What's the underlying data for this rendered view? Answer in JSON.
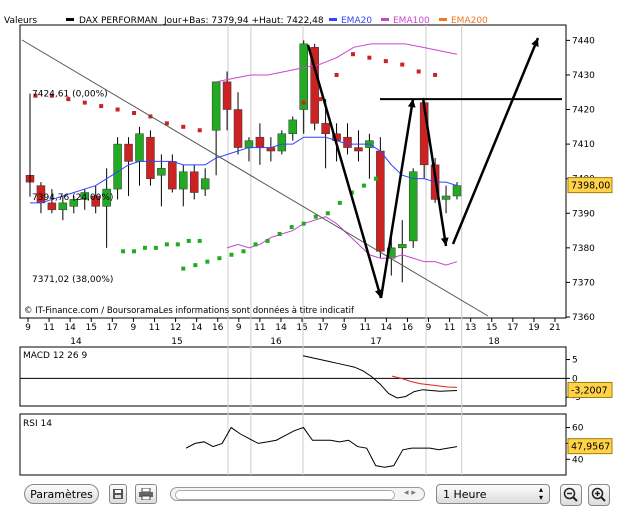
{
  "header": {
    "valeurs": "Valeurs",
    "series_name": "DAX PERFORMAN",
    "jour_info": "Jour+Bas: 7379,94 +Haut: 7422,48",
    "ema20": "EMA20",
    "ema100": "EMA100",
    "ema200": "EMA200"
  },
  "colors": {
    "up": "#22aa22",
    "down": "#cc2222",
    "ema20": "#3344ff",
    "ema100": "#cc44cc",
    "ema200": "#ee7722",
    "sar": "#cc2222",
    "sar_low": "#22aa22"
  },
  "price_labels": {
    "fib0": "7424,61 (0,00%)",
    "fib24": "7394,76 (24,00%)",
    "fib38": "7371,02 (38,00%)",
    "current": "7398,00",
    "watermark": "© IT-Finance.com / BoursoramaLes informations sont données à titre indicatif"
  },
  "chart_data": [
    {
      "type": "candlestick",
      "y_axis": {
        "ticks": [
          "7440",
          "7430",
          "7420",
          "7410",
          "7400",
          "7390",
          "7380",
          "7370",
          "7360"
        ],
        "ylim": [
          7360,
          7443
        ]
      },
      "x_hour_ticks": [
        "9",
        "11",
        "14",
        "15",
        "17",
        "9",
        "11",
        "12",
        "14",
        "16",
        "9",
        "11",
        "14",
        "15",
        "17",
        "9",
        "11",
        "14",
        "16",
        "9",
        "11",
        "13",
        "15",
        "17",
        "19",
        "21"
      ],
      "x_day_labels": [
        "14",
        "15",
        "16",
        "17",
        "18"
      ],
      "candles": [
        {
          "o": 7401,
          "h": 7402,
          "l": 7396,
          "c": 7399
        },
        {
          "o": 7398,
          "h": 7399,
          "l": 7390,
          "c": 7393
        },
        {
          "o": 7393,
          "h": 7397,
          "l": 7390,
          "c": 7391
        },
        {
          "o": 7391,
          "h": 7395,
          "l": 7388,
          "c": 7393
        },
        {
          "o": 7392,
          "h": 7395,
          "l": 7390,
          "c": 7394
        },
        {
          "o": 7394,
          "h": 7397,
          "l": 7391,
          "c": 7396
        },
        {
          "o": 7395,
          "h": 7398,
          "l": 7390,
          "c": 7392
        },
        {
          "o": 7392,
          "h": 7403,
          "l": 7380,
          "c": 7397
        },
        {
          "o": 7397,
          "h": 7412,
          "l": 7394,
          "c": 7410
        },
        {
          "o": 7410,
          "h": 7412,
          "l": 7395,
          "c": 7405
        },
        {
          "o": 7405,
          "h": 7415,
          "l": 7398,
          "c": 7413
        },
        {
          "o": 7412,
          "h": 7414,
          "l": 7398,
          "c": 7400
        },
        {
          "o": 7401,
          "h": 7407,
          "l": 7392,
          "c": 7403
        },
        {
          "o": 7405,
          "h": 7407,
          "l": 7396,
          "c": 7397
        },
        {
          "o": 7397,
          "h": 7404,
          "l": 7392,
          "c": 7402
        },
        {
          "o": 7402,
          "h": 7404,
          "l": 7394,
          "c": 7396
        },
        {
          "o": 7397,
          "h": 7403,
          "l": 7395,
          "c": 7400
        },
        {
          "o": 7414,
          "h": 7428,
          "l": 7401,
          "c": 7428
        },
        {
          "o": 7428,
          "h": 7431,
          "l": 7414,
          "c": 7420
        },
        {
          "o": 7420,
          "h": 7425,
          "l": 7407,
          "c": 7409
        },
        {
          "o": 7409,
          "h": 7412,
          "l": 7405,
          "c": 7411
        },
        {
          "o": 7412,
          "h": 7416,
          "l": 7404,
          "c": 7409
        },
        {
          "o": 7409,
          "h": 7412,
          "l": 7405,
          "c": 7408
        },
        {
          "o": 7408,
          "h": 7414,
          "l": 7407,
          "c": 7413
        },
        {
          "o": 7413,
          "h": 7418,
          "l": 7411,
          "c": 7417
        },
        {
          "o": 7420,
          "h": 7440,
          "l": 7413,
          "c": 7439
        },
        {
          "o": 7438,
          "h": 7439,
          "l": 7414,
          "c": 7416
        },
        {
          "o": 7416,
          "h": 7423,
          "l": 7403,
          "c": 7413
        },
        {
          "o": 7413,
          "h": 7416,
          "l": 7405,
          "c": 7411
        },
        {
          "o": 7412,
          "h": 7416,
          "l": 7407,
          "c": 7409
        },
        {
          "o": 7409,
          "h": 7414,
          "l": 7405,
          "c": 7408
        },
        {
          "o": 7409,
          "h": 7413,
          "l": 7400,
          "c": 7411
        },
        {
          "o": 7408,
          "h": 7412,
          "l": 7377,
          "c": 7379
        },
        {
          "o": 7377,
          "h": 7385,
          "l": 7372,
          "c": 7380
        },
        {
          "o": 7380,
          "h": 7388,
          "l": 7370,
          "c": 7381
        },
        {
          "o": 7382,
          "h": 7403,
          "l": 7380,
          "c": 7402
        },
        {
          "o": 7422,
          "h": 7423,
          "l": 7400,
          "c": 7404
        },
        {
          "o": 7404,
          "h": 7406,
          "l": 7393,
          "c": 7394
        },
        {
          "o": 7394,
          "h": 7398,
          "l": 7390,
          "c": 7395
        },
        {
          "o": 7395,
          "h": 7399,
          "l": 7394,
          "c": 7398
        }
      ],
      "ema20": [
        7393,
        7393,
        7394,
        7395,
        7396,
        7397,
        7398,
        7400,
        7402,
        7404,
        7405,
        7405,
        7405,
        7405,
        7404,
        7404,
        7404,
        7406,
        7407,
        7408,
        7409,
        7409,
        7409,
        7410,
        7410,
        7412,
        7412,
        7412,
        7411,
        7410,
        7410,
        7410,
        7408,
        7404,
        7401,
        7400,
        7400,
        7399,
        7399,
        7398
      ],
      "ema100_upper": [
        7428,
        7429,
        7430,
        7430,
        7431,
        7432,
        7433,
        7435,
        7438,
        7439,
        7439,
        7439,
        7438,
        7437,
        7436
      ],
      "ema100_lower": [
        7380,
        7381,
        7380,
        7381,
        7383,
        7384,
        7385,
        7387,
        7388,
        7389,
        7387,
        7384,
        7381,
        7378,
        7377,
        7377,
        7378,
        7377,
        7376,
        7376,
        7375,
        7376
      ],
      "sar_upper": [
        7424,
        7424,
        7423,
        7422,
        7421,
        7420,
        7419,
        7418,
        7416,
        7415,
        7414,
        7422,
        7423,
        7430,
        7436,
        7435,
        7434,
        7433,
        7431,
        7430
      ],
      "sar_lower": [
        7379,
        7379,
        7380,
        7380,
        7381,
        7381,
        7382,
        7382,
        7374,
        7375,
        7376,
        7377,
        7378,
        7379,
        7381,
        7382,
        7384,
        7386,
        7387,
        7389,
        7390,
        7393,
        7396,
        7398,
        7400
      ],
      "fibonacci_levels": [
        {
          "label": "7424,61 (0,00%)",
          "value": 7424.61
        },
        {
          "label": "7394,76 (24,00%)",
          "value": 7394.76
        },
        {
          "label": "7371,02 (38,00%)",
          "value": 7371.02
        }
      ],
      "current_price": 7398.0
    },
    {
      "type": "line",
      "title": "MACD 12 26 9",
      "ylim": [
        -6,
        7
      ],
      "ticks": [
        "5",
        "0",
        "-5"
      ],
      "current_value": "-3,2007",
      "macd": [
        6.0,
        5.5,
        5.0,
        4.5,
        4.0,
        3.5,
        3.0,
        2.0,
        0.5,
        -1.5,
        -4.0,
        -5.2,
        -4.8,
        -3.5,
        -3.0,
        -3.2,
        -3.4,
        -3.3,
        -3.2
      ],
      "signal": [
        0.6,
        0.0,
        -0.8,
        -1.4,
        -1.7,
        -2.0,
        -2.3,
        -2.4
      ]
    },
    {
      "type": "line",
      "title": "RSI 14",
      "ylim": [
        32,
        66
      ],
      "ticks": [
        "60",
        "50",
        "40"
      ],
      "current_value": "47,9567",
      "rsi": [
        47,
        50,
        51,
        48,
        50,
        60,
        56,
        53,
        50,
        51,
        52,
        55,
        58,
        60,
        52,
        52,
        52,
        51,
        52,
        48,
        47,
        36,
        35,
        36,
        46,
        47,
        47,
        47,
        46,
        47,
        48
      ]
    }
  ],
  "toolbar": {
    "params_label": "Paramètres",
    "period_label": "1 Heure"
  }
}
